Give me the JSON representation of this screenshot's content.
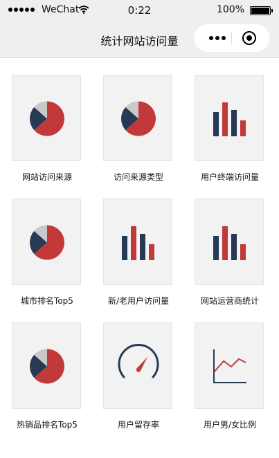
{
  "status_bar": {
    "carrier": "WeChat",
    "time": "0:22",
    "battery": "100%"
  },
  "nav": {
    "title": "统计网站访问量",
    "more_icon": "more-dots-icon",
    "close_icon": "target-circle-icon"
  },
  "colors": {
    "red": "#c2393a",
    "navy": "#273a55",
    "gray": "#c9c9c9"
  },
  "items": [
    {
      "label": "网站访问来源",
      "icon": "pie-chart-icon"
    },
    {
      "label": "访问来源类型",
      "icon": "pie-chart-icon"
    },
    {
      "label": "用户终端访问量",
      "icon": "bar-chart-icon"
    },
    {
      "label": "城市排名Top5",
      "icon": "pie-chart-icon"
    },
    {
      "label": "新/老用户访问量",
      "icon": "bar-chart-icon"
    },
    {
      "label": "网站运营商统计",
      "icon": "bar-chart-icon"
    },
    {
      "label": "热销品排名Top5",
      "icon": "pie-chart-icon"
    },
    {
      "label": "用户留存率",
      "icon": "gauge-icon"
    },
    {
      "label": "用户男/女比例",
      "icon": "line-chart-icon"
    }
  ]
}
